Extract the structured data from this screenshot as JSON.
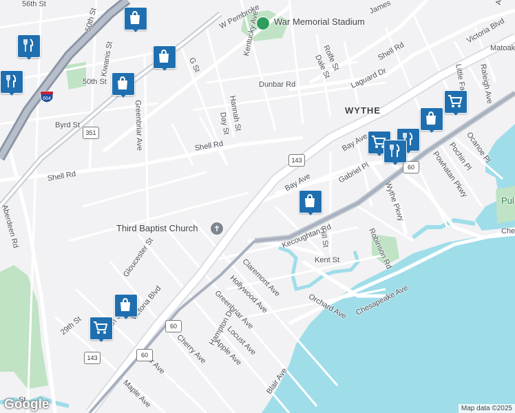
{
  "map": {
    "streets": {
      "s56th": "56th St",
      "s50th_top": "50th St",
      "s50th": "50th St",
      "kiwanis": "Kiwanis St",
      "w_pembroke": "W Pembroke",
      "kentucky": "Kentucky Ave",
      "james": "James",
      "victoria_ne": "Victoria Blvd",
      "matoaka": "Matoak",
      "shell_top": "Shell Rd",
      "rolfe": "Rolfe St",
      "dale": "Dale St",
      "g_st": "G St",
      "dunbar": "Dunbar Rd",
      "laguard": "Laguard Dr",
      "hannah": "Hannah St",
      "day": "Day St",
      "byrd": "Byrd St",
      "greenbriar_n": "Greenbriar Ave",
      "little_f": "Little Fa",
      "raleigh": "Raleigh Ave",
      "ave_top": "Ave",
      "ocanoe": "Ocanoe Pl",
      "pochin": "Pochin Pl",
      "powhatan": "Powhatan Pkwy",
      "bay_e": "Bay Ave",
      "bay_w": "Bay Ave",
      "gabriel": "Gabriel Pl",
      "shell_mid": "Shell Rd",
      "shell_w": "Shell Rd",
      "aberdeen": "Aberdeen Rd",
      "gloucester": "Gloucester St",
      "kecoughtan": "Kecoughtan Rd",
      "wythe_pkwy": "Wythe Pkwy",
      "hill": "Hill St",
      "robinson": "Robinson Rd",
      "claremont": "Claremont Ave",
      "kent": "Kent St",
      "hollywood": "Hollywood Ave",
      "greenbriar_s": "Greenbriar Ave",
      "orchard": "Orchard Ave",
      "chesapeake": "Chesapeake Ave",
      "che_edge": "Che",
      "victoria_sw": "Victoria Blvd",
      "th_st": "th St",
      "s29th": "29th St",
      "hampton": "Hampton Dr",
      "locust": "Locust Ave",
      "apple": "Apple Ave",
      "cherry": "Cherry Ave",
      "pear": "Pear Ave",
      "blair": "Blair Ave",
      "maple": "Maple Ave",
      "st_bottom": "St"
    },
    "area_label": "WYTHE",
    "poi": {
      "stadium": "War Memorial Stadium",
      "church": "Third Baptist Church",
      "park_edge": "Pul"
    },
    "route_shields": {
      "r351": "351",
      "r143_n": "143",
      "r60_e": "60",
      "r60_s": "60",
      "r60_sw": "60",
      "r143_s": "143",
      "i664": "664"
    },
    "markers": [
      {
        "type": "shopping",
        "icon": "shopping-bag-icon"
      },
      {
        "type": "restaurant",
        "icon": "fork-knife-icon"
      },
      {
        "type": "shopping",
        "icon": "shopping-bag-icon"
      },
      {
        "type": "restaurant",
        "icon": "fork-knife-icon"
      },
      {
        "type": "shopping",
        "icon": "shopping-bag-icon"
      },
      {
        "type": "grocery",
        "icon": "shopping-cart-icon"
      },
      {
        "type": "shopping",
        "icon": "shopping-bag-icon"
      },
      {
        "type": "grocery",
        "icon": "shopping-cart-icon"
      },
      {
        "type": "restaurant",
        "icon": "fork-knife-icon"
      },
      {
        "type": "restaurant",
        "icon": "fork-knife-icon"
      },
      {
        "type": "shopping",
        "icon": "shopping-bag-icon"
      },
      {
        "type": "shopping",
        "icon": "shopping-bag-icon"
      },
      {
        "type": "grocery",
        "icon": "shopping-cart-icon"
      }
    ],
    "colors": {
      "water": "#9fdde9",
      "park": "#bfe3c4",
      "marker": "#1f6fb0",
      "highway": "#9aa4b4"
    },
    "google_logo": "Google",
    "attribution": "Map data ©2025"
  }
}
